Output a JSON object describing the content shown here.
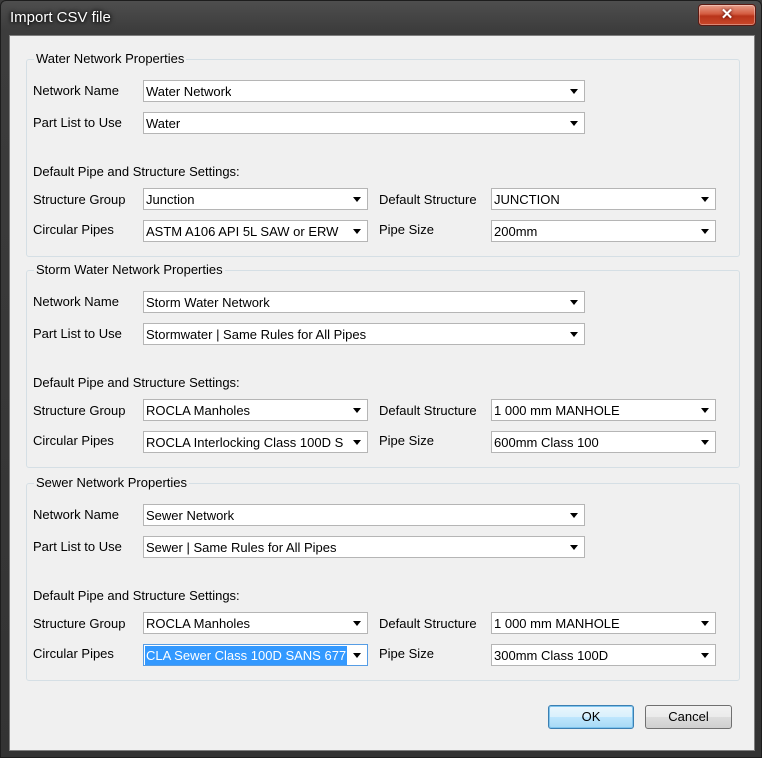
{
  "window": {
    "title": "Import CSV file",
    "close_glyph": "✕"
  },
  "sections": [
    {
      "title": "Water Network Properties",
      "network_name_label": "Network Name",
      "network_name_value": "Water Network",
      "part_list_label": "Part List to Use",
      "part_list_value": "Water",
      "defaults_heading": "Default Pipe and Structure Settings:",
      "structure_group_label": "Structure Group",
      "structure_group_value": "Junction",
      "default_structure_label": "Default Structure",
      "default_structure_value": "JUNCTION",
      "circular_pipes_label": "Circular Pipes",
      "circular_pipes_value": "ASTM A106 API 5L SAW or ERW",
      "pipe_size_label": "Pipe Size",
      "pipe_size_value": "200mm"
    },
    {
      "title": "Storm Water Network Properties",
      "network_name_label": "Network Name",
      "network_name_value": "Storm Water Network",
      "part_list_label": "Part List to Use",
      "part_list_value": "Stormwater | Same Rules for All Pipes",
      "defaults_heading": "Default Pipe and Structure Settings:",
      "structure_group_label": "Structure Group",
      "structure_group_value": "ROCLA Manholes",
      "default_structure_label": "Default Structure",
      "default_structure_value": "1 000 mm MANHOLE",
      "circular_pipes_label": "Circular Pipes",
      "circular_pipes_value": "ROCLA Interlocking Class 100D S",
      "pipe_size_label": "Pipe Size",
      "pipe_size_value": "600mm Class 100"
    },
    {
      "title": "Sewer Network Properties",
      "network_name_label": "Network Name",
      "network_name_value": "Sewer Network",
      "part_list_label": "Part List to Use",
      "part_list_value": "Sewer | Same Rules for All Pipes",
      "defaults_heading": "Default Pipe and Structure Settings:",
      "structure_group_label": "Structure Group",
      "structure_group_value": "ROCLA Manholes",
      "default_structure_label": "Default Structure",
      "default_structure_value": "1 000 mm MANHOLE",
      "circular_pipes_label": "Circular Pipes",
      "circular_pipes_value": "CLA Sewer Class 100D SANS 677",
      "pipe_size_label": "Pipe Size",
      "pipe_size_value": "300mm Class 100D"
    }
  ],
  "buttons": {
    "ok": "OK",
    "cancel": "Cancel"
  },
  "colors": {
    "selection": "#3399ff",
    "close_button": "#c9482b"
  }
}
